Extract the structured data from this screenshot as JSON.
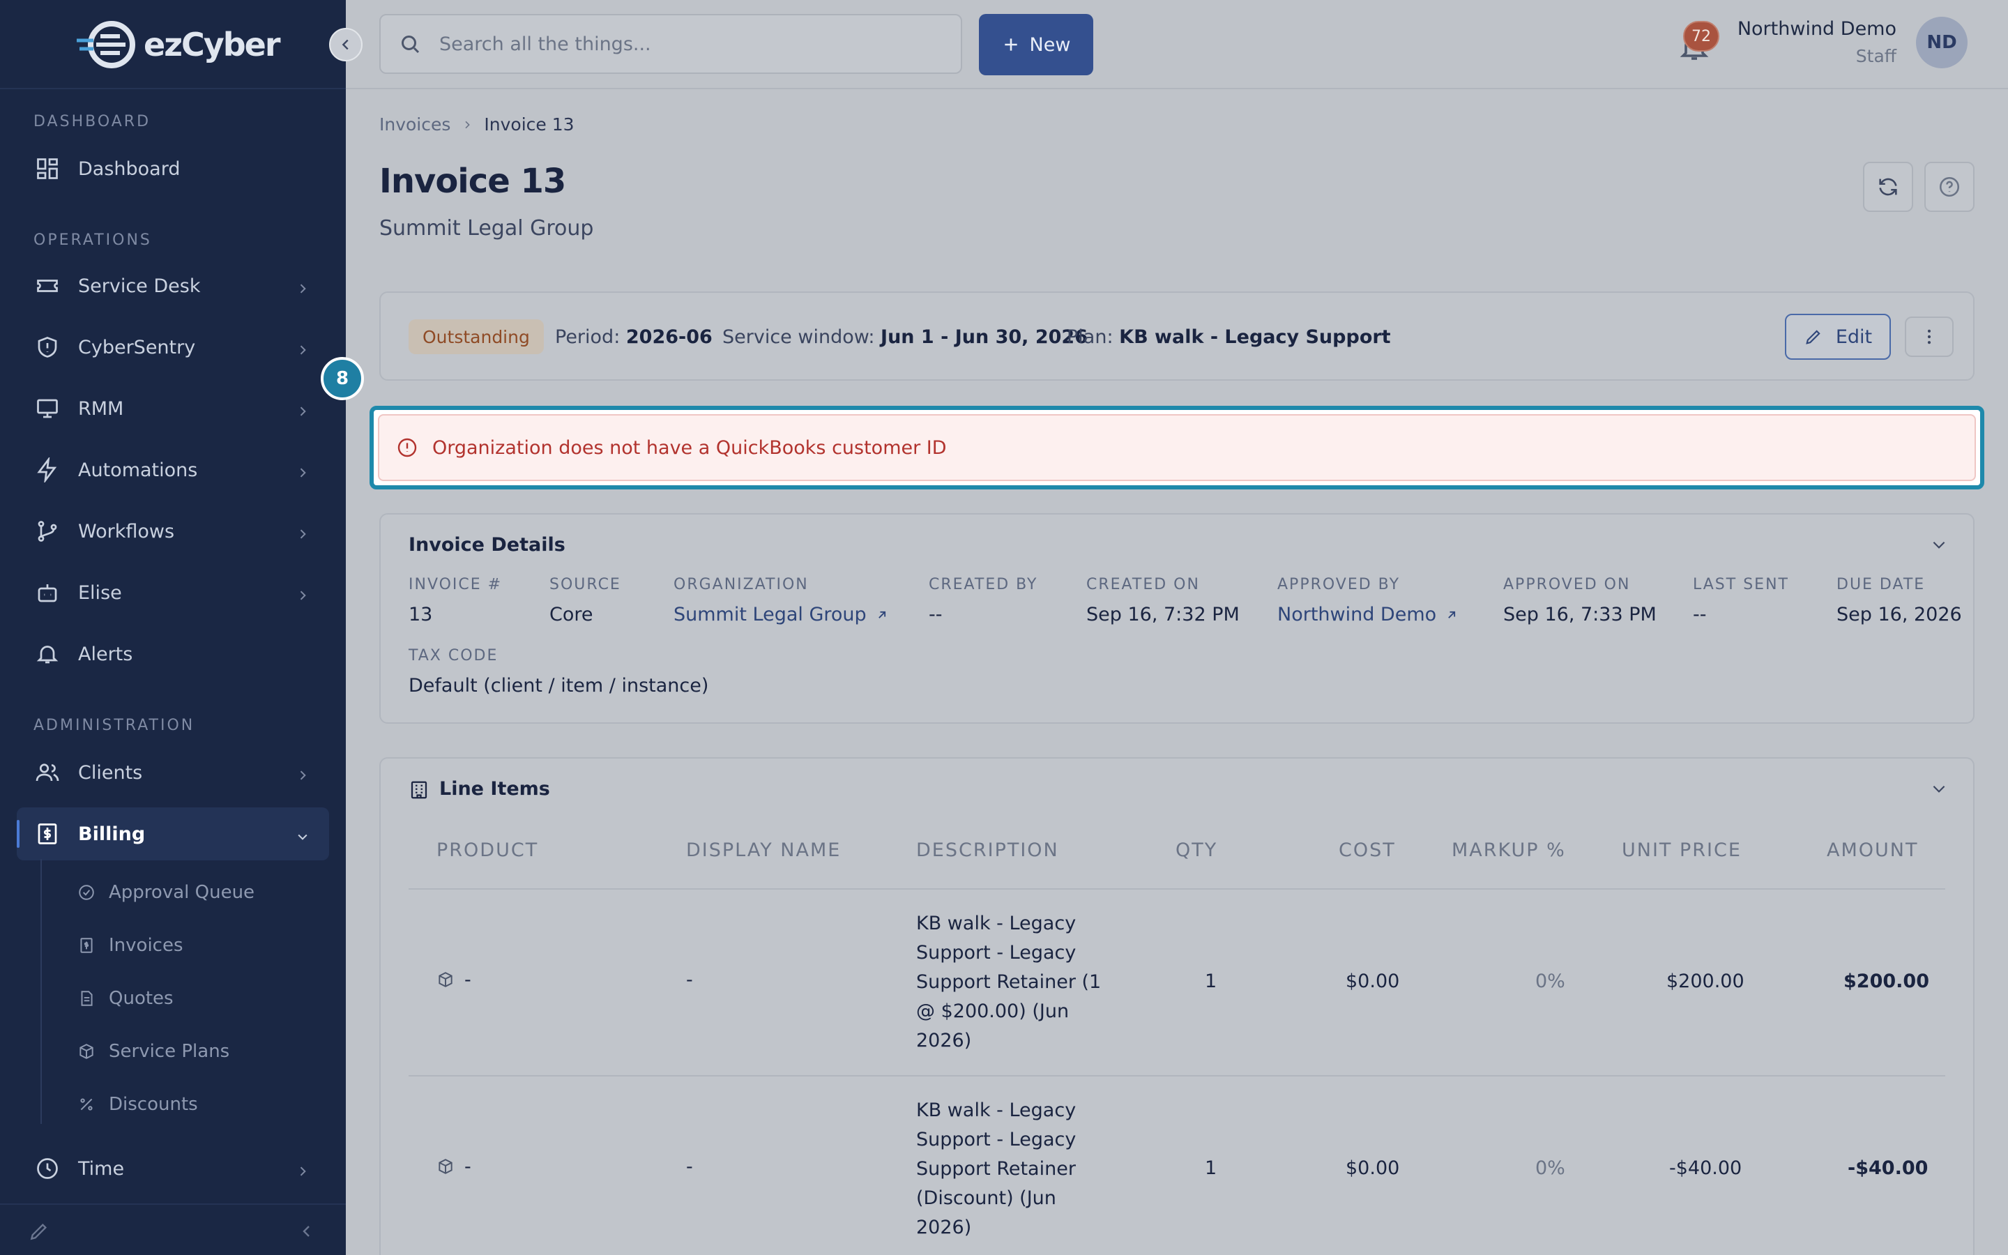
{
  "sidebar": {
    "logo_text": "ezCyber",
    "sections": {
      "dashboard": "DASHBOARD",
      "operations": "OPERATIONS",
      "administration": "ADMINISTRATION"
    },
    "items": {
      "dashboard": "Dashboard",
      "service_desk": "Service Desk",
      "cybersentry": "CyberSentry",
      "rmm": "RMM",
      "automations": "Automations",
      "workflows": "Workflows",
      "elise": "Elise",
      "alerts": "Alerts",
      "clients": "Clients",
      "billing": "Billing",
      "time": "Time"
    },
    "billing_sub": {
      "approval_queue": "Approval Queue",
      "invoices": "Invoices",
      "quotes": "Quotes",
      "service_plans": "Service Plans",
      "discounts": "Discounts"
    }
  },
  "topbar": {
    "search_placeholder": "Search all the things...",
    "new_label": "New",
    "notification_count": "72",
    "user_name": "Northwind Demo",
    "user_role": "Staff",
    "avatar_initials": "ND"
  },
  "breadcrumb": {
    "parent": "Invoices",
    "current": "Invoice 13"
  },
  "page": {
    "title": "Invoice 13",
    "subtitle": "Summit Legal Group"
  },
  "summary": {
    "status": "Outstanding",
    "period_label": "Period:",
    "period_value": "2026-06",
    "window_label": "Service window:",
    "window_value": "Jun 1 - Jun 30, 2026",
    "plan_label": "Plan:",
    "plan_value": "KB walk - Legacy Support",
    "edit_label": "Edit"
  },
  "step_marker": "8",
  "alert": {
    "message": "Organization does not have a QuickBooks customer ID"
  },
  "details": {
    "title": "Invoice Details",
    "fields": {
      "invoice_no": {
        "label": "INVOICE #",
        "value": "13"
      },
      "source": {
        "label": "SOURCE",
        "value": "Core"
      },
      "organization": {
        "label": "ORGANIZATION",
        "value": "Summit Legal Group"
      },
      "created_by": {
        "label": "CREATED BY",
        "value": "--"
      },
      "created_on": {
        "label": "CREATED ON",
        "value": "Sep 16, 7:32 PM"
      },
      "approved_by": {
        "label": "APPROVED BY",
        "value": "Northwind Demo"
      },
      "approved_on": {
        "label": "APPROVED ON",
        "value": "Sep 16, 7:33 PM"
      },
      "last_sent": {
        "label": "LAST SENT",
        "value": "--"
      },
      "due_date": {
        "label": "DUE DATE",
        "value": "Sep 16, 2026"
      },
      "tax_code": {
        "label": "TAX CODE",
        "value": "Default (client / item / instance)"
      }
    }
  },
  "line_items": {
    "title": "Line Items",
    "columns": {
      "product": "PRODUCT",
      "display_name": "DISPLAY NAME",
      "description": "DESCRIPTION",
      "qty": "QTY",
      "cost": "COST",
      "markup": "MARKUP %",
      "unit_price": "UNIT PRICE",
      "amount": "AMOUNT"
    },
    "rows": [
      {
        "product": "-",
        "display_name": "-",
        "description": [
          "KB walk - Legacy",
          "Support - Legacy",
          "Support Retainer (1",
          "@ $200.00) (Jun",
          "2026)"
        ],
        "qty": "1",
        "cost": "$0.00",
        "markup": "0%",
        "unit_price": "$200.00",
        "amount": "$200.00"
      },
      {
        "product": "-",
        "display_name": "-",
        "description": [
          "KB walk - Legacy",
          "Support - Legacy",
          "Support Retainer",
          "(Discount) (Jun",
          "2026)"
        ],
        "qty": "1",
        "cost": "$0.00",
        "markup": "0%",
        "unit_price": "-$40.00",
        "amount": "-$40.00"
      }
    ]
  }
}
